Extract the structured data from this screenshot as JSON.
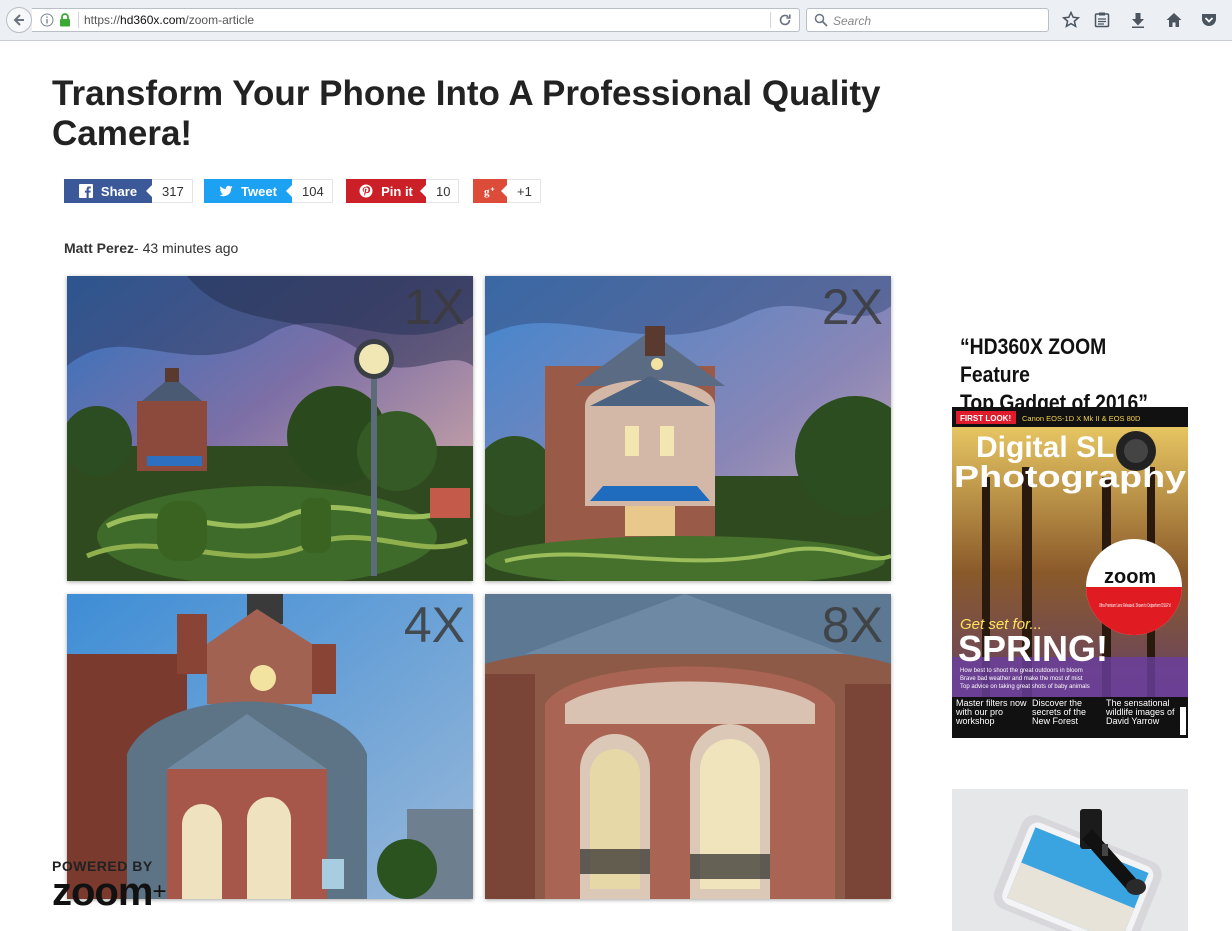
{
  "browser": {
    "url_prefix": "https://",
    "url_host": "hd360x.com",
    "url_path": "/zoom-article",
    "search_placeholder": "Search"
  },
  "article": {
    "title": "Transform Your Phone Into A Professional Quality Camera!",
    "author": "Matt Perez",
    "time": "- 43 minutes ago"
  },
  "share": [
    {
      "label": "Share",
      "count": "317",
      "color": "#3b5998",
      "icon": "facebook-icon"
    },
    {
      "label": "Tweet",
      "count": "104",
      "color": "#1da1f2",
      "icon": "twitter-icon"
    },
    {
      "label": "Pin it",
      "count": "10",
      "color": "#cb2027",
      "icon": "pinterest-icon"
    },
    {
      "label": "",
      "count": "+1",
      "color": "#dd4b39",
      "icon": "google-plus-icon"
    }
  ],
  "gallery": {
    "labels": [
      "1X",
      "2X",
      "4X",
      "8X"
    ]
  },
  "branding": {
    "powered_by": "POWERED BY",
    "logo": "zoom"
  },
  "sidebar": {
    "feature_line1": "“HD360X ZOOM Feature",
    "feature_line2": "Top Gadget of 2016”",
    "magazine": {
      "tag": "FIRST LOOK!",
      "tag_detail": "Canon EOS-1D X Mk II & EOS 80D",
      "title1": "Digital SL",
      "title2": "Photography",
      "headline_small": "Get set for...",
      "headline": "SPRING!",
      "badge_logo": "zoom",
      "badge_text": "Ultra Premium Lens Released. Shown to Outperform DSLR's!",
      "bullets": [
        "How best to shoot the great outdoors in bloom",
        "Brave bad weather and make the most of mist",
        "Top advice on taking great shots of baby animals"
      ],
      "col1": "Master filters now with our pro workshop",
      "col2": "Discover the secrets of the New Forest",
      "col3": "The sensational wildlife images of David Yarrow"
    }
  }
}
